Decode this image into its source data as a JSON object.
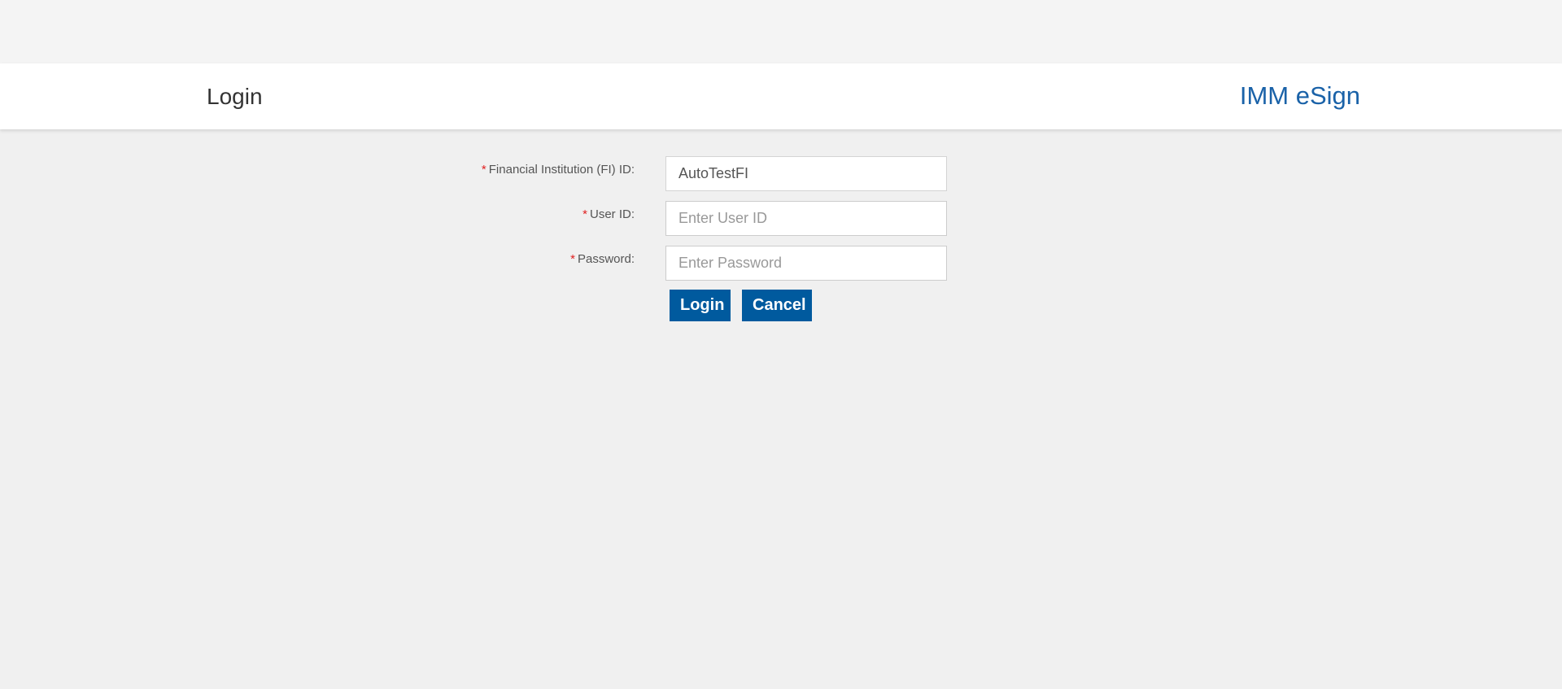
{
  "header": {
    "page_title": "Login",
    "brand": "IMM eSign",
    "brand_color": "#1a62a8"
  },
  "form": {
    "required_marker": "*",
    "fields": [
      {
        "label": "Financial Institution (FI) ID:",
        "value": "AutoTestFI",
        "placeholder": ""
      },
      {
        "label": "User ID:",
        "value": "",
        "placeholder": "Enter User ID"
      },
      {
        "label": "Password:",
        "value": "",
        "placeholder": "Enter Password"
      }
    ],
    "login_label": "Login",
    "cancel_label": "Cancel",
    "button_color": "#005a9e"
  }
}
